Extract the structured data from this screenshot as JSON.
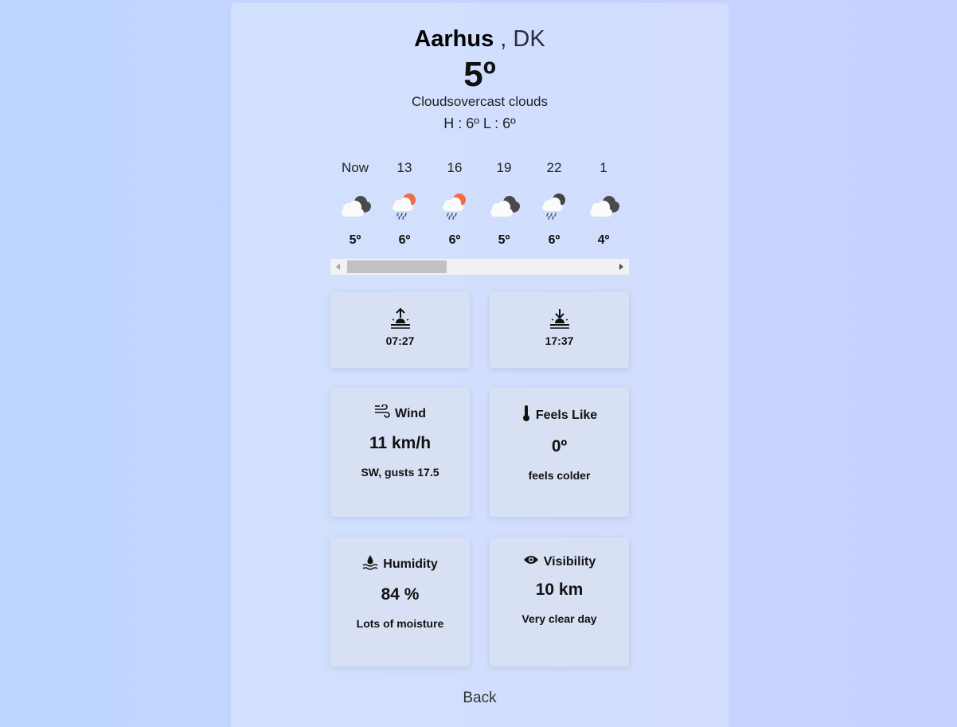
{
  "location": {
    "city": "Aarhus",
    "country": ", DK"
  },
  "current": {
    "temperature": "5º",
    "description": "Cloudsovercast clouds",
    "high_low": "H : 6º L : 6º"
  },
  "hourly": [
    {
      "label": "Now",
      "temp": "5º",
      "icon": "cloudy-icon"
    },
    {
      "label": "13",
      "temp": "6º",
      "icon": "sun-rain-icon"
    },
    {
      "label": "16",
      "temp": "6º",
      "icon": "sun-rain-icon"
    },
    {
      "label": "19",
      "temp": "5º",
      "icon": "cloudy-icon"
    },
    {
      "label": "22",
      "temp": "6º",
      "icon": "night-rain-icon"
    },
    {
      "label": "1",
      "temp": "4º",
      "icon": "cloudy-icon"
    }
  ],
  "sun": {
    "sunrise": "07:27",
    "sunset": "17:37"
  },
  "wind": {
    "title": "Wind",
    "value": "11 km/h",
    "note": "SW, gusts 17.5"
  },
  "feels_like": {
    "title": "Feels Like",
    "value": "0º",
    "note": "feels colder"
  },
  "humidity": {
    "title": "Humidity",
    "value": "84 %",
    "note": "Lots of moisture"
  },
  "visibility": {
    "title": "Visibility",
    "value": "10 km",
    "note": "Very clear day"
  },
  "back_label": "Back",
  "colors": {
    "background": "#bdd6ff",
    "panel": "#d1e1fd",
    "card": "#d8e1f4",
    "sun_orange": "#ef6c45"
  }
}
